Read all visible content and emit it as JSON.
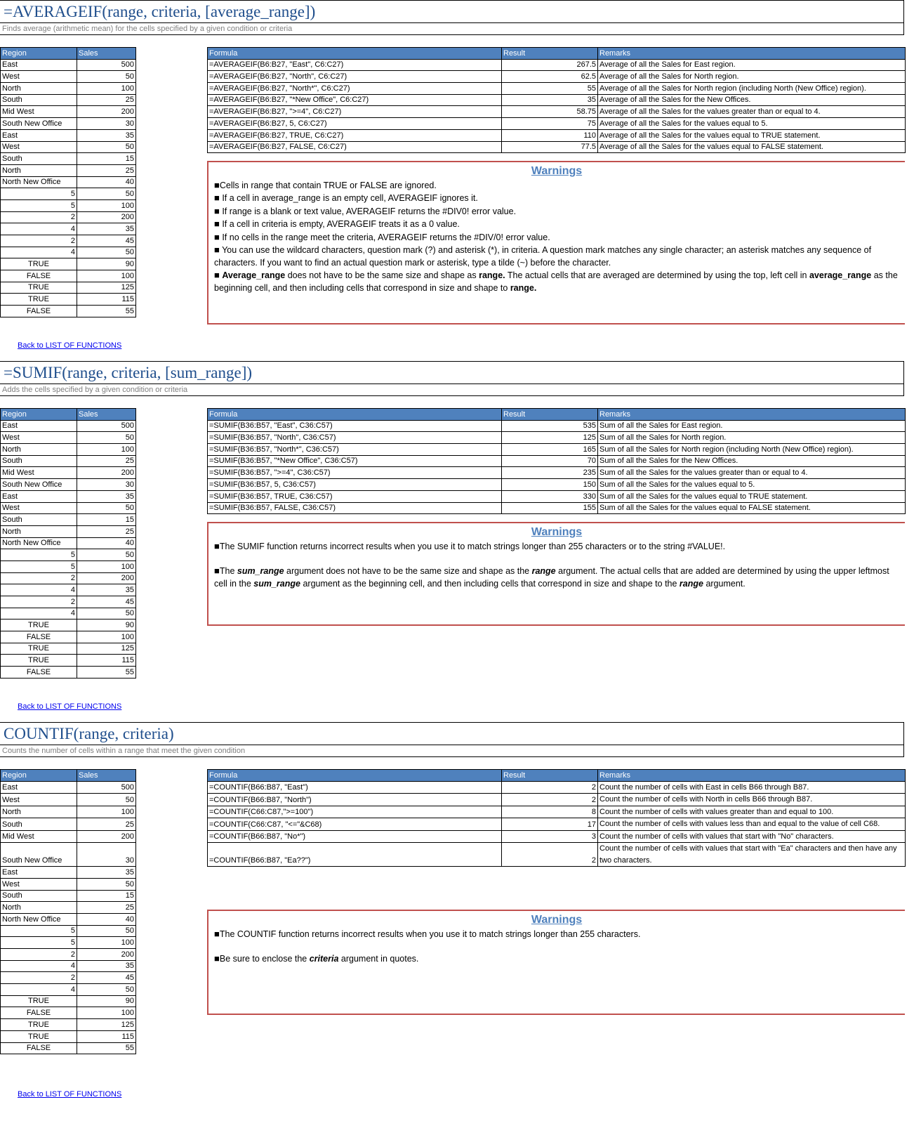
{
  "colors": {
    "title": "#1f4e8c",
    "header_fill": "#4f81bd",
    "warning_border": "#c0504d",
    "warning_title": "#4f81bd",
    "link": "#0000ee"
  },
  "sections": [
    {
      "title": "=AVERAGEIF(range, criteria, [average_range])",
      "subtitle": "Finds average (arithmetic mean) for the cells specified by a given condition or criteria",
      "left_headers": [
        "Region",
        "Sales"
      ],
      "left_rows": [
        [
          "East",
          "500"
        ],
        [
          "West",
          "50"
        ],
        [
          "North",
          "100"
        ],
        [
          "South",
          "25"
        ],
        [
          "Mid West",
          "200"
        ],
        [
          "South New Office",
          "30"
        ],
        [
          "East",
          "35"
        ],
        [
          "West",
          "50"
        ],
        [
          "South",
          "15"
        ],
        [
          "North",
          "25"
        ],
        [
          "North New Office",
          "40"
        ],
        [
          "5",
          "50"
        ],
        [
          "5",
          "100"
        ],
        [
          "2",
          "200"
        ],
        [
          "4",
          "35"
        ],
        [
          "2",
          "45"
        ],
        [
          "4",
          "50"
        ],
        [
          "TRUE",
          "90"
        ],
        [
          "FALSE",
          "100"
        ],
        [
          "TRUE",
          "125"
        ],
        [
          "TRUE",
          "115"
        ],
        [
          "FALSE",
          "55"
        ]
      ],
      "right_headers": [
        "Formula",
        "Result",
        "Remarks"
      ],
      "right_rows": [
        [
          "=AVERAGEIF(B6:B27, \"East\", C6:C27)",
          "267.5",
          "Average of all the Sales for East region."
        ],
        [
          "=AVERAGEIF(B6:B27, \"North\", C6:C27)",
          "62.5",
          "Average of all the Sales for North region."
        ],
        [
          "=AVERAGEIF(B6:B27, \"North*\", C6:C27)",
          "55",
          "Average of all the Sales for North region (including North (New Office) region)."
        ],
        [
          "=AVERAGEIF(B6:B27, \"*New Office\", C6:C27)",
          "35",
          "Average of all the Sales for the New Offices."
        ],
        [
          "=AVERAGEIF(B6:B27, \">=4\", C6:C27)",
          "58.75",
          "Average of all the Sales for the values greater than or equal to 4."
        ],
        [
          "=AVERAGEIF(B6:B27, 5, C6:C27)",
          "75",
          "Average of all the Sales for the values equal to 5."
        ],
        [
          "=AVERAGEIF(B6:B27, TRUE, C6:C27)",
          "110",
          "Average of all the Sales for the values equal to TRUE statement."
        ],
        [
          "=AVERAGEIF(B6:B27, FALSE, C6:C27)",
          "77.5",
          "Average of all the Sales for the values equal to FALSE statement."
        ]
      ],
      "warnings_title": "Warnings",
      "warnings": [
        [
          {
            "t": "Cells in range that contain TRUE or FALSE are ignored."
          }
        ],
        [
          {
            "t": " If a cell in average_range is an empty cell, AVERAGEIF ignores it."
          }
        ],
        [
          {
            "t": " If range is a blank or text value, AVERAGEIF returns the #DIV0! error value."
          }
        ],
        [
          {
            "t": " If a cell in criteria is empty, AVERAGEIF treats it as a 0 value."
          }
        ],
        [
          {
            "t": " If no cells in the range meet the criteria, AVERAGEIF returns the #DIV/0! error value."
          }
        ],
        [
          {
            "t": " You can use the wildcard characters, question mark (?) and asterisk (*), in criteria. A question mark matches any single character; an asterisk matches any sequence of characters. If you want to find an actual question mark or asterisk, type a tilde (~) before the character."
          }
        ],
        [
          {
            "t": " "
          },
          {
            "t": "Average_range",
            "b": true
          },
          {
            "t": " does not have to be the same size and shape as "
          },
          {
            "t": "range.",
            "b": true
          },
          {
            "t": " The actual cells that are averaged are determined by using the top, left cell in "
          },
          {
            "t": "average_range",
            "b": true
          },
          {
            "t": " as the beginning cell, and then including cells that correspond in size and shape to "
          },
          {
            "t": "range.",
            "b": true
          }
        ]
      ],
      "warnings_gap": false,
      "back_link": "Back to LIST OF FUNCTIONS"
    },
    {
      "title": "=SUMIF(range, criteria, [sum_range])",
      "subtitle": "Adds the cells specified by a given condition or criteria",
      "left_headers": [
        "Region",
        "Sales"
      ],
      "left_rows": [
        [
          "East",
          "500"
        ],
        [
          "West",
          "50"
        ],
        [
          "North",
          "100"
        ],
        [
          "South",
          "25"
        ],
        [
          "Mid West",
          "200"
        ],
        [
          "South New Office",
          "30"
        ],
        [
          "East",
          "35"
        ],
        [
          "West",
          "50"
        ],
        [
          "South",
          "15"
        ],
        [
          "North",
          "25"
        ],
        [
          "North New Office",
          "40"
        ],
        [
          "5",
          "50"
        ],
        [
          "5",
          "100"
        ],
        [
          "2",
          "200"
        ],
        [
          "4",
          "35"
        ],
        [
          "2",
          "45"
        ],
        [
          "4",
          "50"
        ],
        [
          "TRUE",
          "90"
        ],
        [
          "FALSE",
          "100"
        ],
        [
          "TRUE",
          "125"
        ],
        [
          "TRUE",
          "115"
        ],
        [
          "FALSE",
          "55"
        ]
      ],
      "right_headers": [
        "Formula",
        "Result",
        "Remarks"
      ],
      "right_rows": [
        [
          "=SUMIF(B36:B57, \"East\", C36:C57)",
          "535",
          "Sum of all the Sales for East region."
        ],
        [
          "=SUMIF(B36:B57, \"North\", C36:C57)",
          "125",
          "Sum of all the Sales for North region."
        ],
        [
          "=SUMIF(B36:B57, \"North*\", C36:C57)",
          "165",
          "Sum of all the Sales for North region (including North (New Office) region)."
        ],
        [
          "=SUMIF(B36:B57, \"*New Office\", C36:C57)",
          "70",
          "Sum of all the Sales for the New Offices."
        ],
        [
          "=SUMIF(B36:B57, \">=4\", C36:C57)",
          "235",
          "Sum of all the Sales for the values greater than or equal to 4."
        ],
        [
          "=SUMIF(B36:B57, 5, C36:C57)",
          "150",
          "Sum of all the Sales for the values equal to 5."
        ],
        [
          "=SUMIF(B36:B57, TRUE, C36:C57)",
          "330",
          "Sum of all the Sales for the values equal to TRUE statement."
        ],
        [
          "=SUMIF(B36:B57, FALSE, C36:C57)",
          "155",
          "Sum of all the Sales for the values equal to FALSE statement."
        ]
      ],
      "warnings_title": "Warnings",
      "warnings": [
        [
          {
            "t": "The SUMIF function returns incorrect results when you use it to match strings longer than 255 characters or to the string #VALUE!."
          }
        ],
        [
          {
            "t": "The "
          },
          {
            "t": "sum_range",
            "b": true,
            "i": true
          },
          {
            "t": " argument does not have to be the same size and shape as the "
          },
          {
            "t": "range",
            "b": true,
            "i": true
          },
          {
            "t": " argument. The actual cells that are added are determined by using the upper leftmost cell in the "
          },
          {
            "t": "sum_range",
            "b": true,
            "i": true
          },
          {
            "t": " argument as the beginning cell, and then including cells that correspond in size and shape to the "
          },
          {
            "t": "range",
            "b": true,
            "i": true
          },
          {
            "t": " argument."
          }
        ]
      ],
      "warnings_gap": true,
      "back_link": "Back to LIST OF FUNCTIONS"
    },
    {
      "title": "COUNTIF(range, criteria)",
      "subtitle": "Counts the number of cells within a range that meet the given condition",
      "left_headers": [
        "Region",
        "Sales"
      ],
      "left_rows": [
        [
          "East",
          "500"
        ],
        [
          "West",
          "50"
        ],
        [
          "North",
          "100"
        ],
        [
          "South",
          "25"
        ],
        [
          "Mid West",
          "200"
        ],
        [
          "South New Office",
          "30"
        ],
        [
          "East",
          "35"
        ],
        [
          "West",
          "50"
        ],
        [
          "South",
          "15"
        ],
        [
          "North",
          "25"
        ],
        [
          "North New Office",
          "40"
        ],
        [
          "5",
          "50"
        ],
        [
          "5",
          "100"
        ],
        [
          "2",
          "200"
        ],
        [
          "4",
          "35"
        ],
        [
          "2",
          "45"
        ],
        [
          "4",
          "50"
        ],
        [
          "TRUE",
          "90"
        ],
        [
          "FALSE",
          "100"
        ],
        [
          "TRUE",
          "125"
        ],
        [
          "TRUE",
          "115"
        ],
        [
          "FALSE",
          "55"
        ]
      ],
      "right_headers": [
        "Formula",
        "Result",
        "Remarks"
      ],
      "right_rows": [
        [
          "=COUNTIF(B66:B87, \"East\")",
          "2",
          "Count the number of cells with East in cells B66 through B87."
        ],
        [
          "=COUNTIF(B66:B87, \"North\")",
          "2",
          "Count the number of cells with North in cells B66 through B87."
        ],
        [
          "=COUNTIF(C66:C87,\">=100\")",
          "8",
          "Count the number of cells with values greater than and equal to 100."
        ],
        [
          "=COUNTIF(C66:C87, \"<=\"&C68)",
          "17",
          "Count the number of cells with values less than and equal to the value of cell C68."
        ],
        [
          "=COUNTIF(B66:B87, \"No*\")",
          "3",
          "Count the number of cells with values that start with \"No\" characters."
        ],
        [
          "=COUNTIF(B66:B87, \"Ea??\")",
          "2",
          "Count the number of cells with values that start with \"Ea\" characters and then have any two characters."
        ]
      ],
      "warnings_title": "Warnings",
      "warnings": [
        [
          {
            "t": "The COUNTIF function returns incorrect results when you use it to match strings longer than 255 characters."
          }
        ],
        [
          {
            "t": "Be sure to enclose the "
          },
          {
            "t": "criteria",
            "b": true,
            "i": true
          },
          {
            "t": " argument in quotes."
          }
        ]
      ],
      "warnings_gap": true,
      "back_link": "Back to LIST OF FUNCTIONS"
    }
  ]
}
